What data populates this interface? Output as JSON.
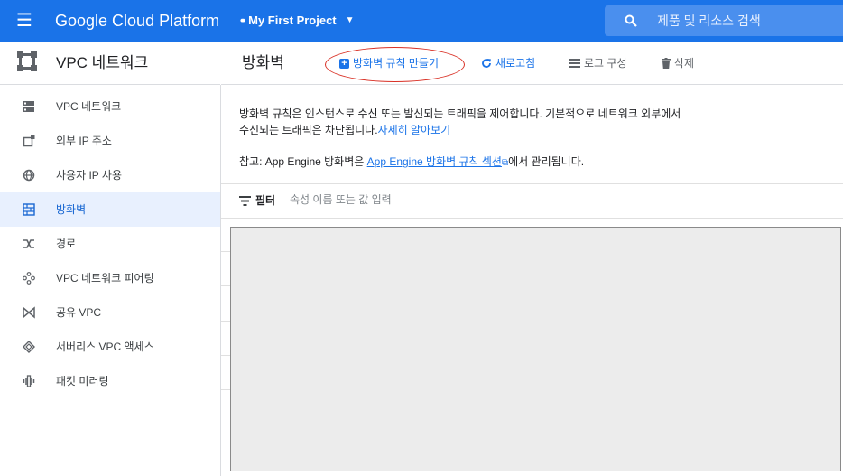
{
  "topbar": {
    "brand": "Google Cloud Platform",
    "project": "My First Project",
    "search_placeholder": "제품 및 리소스 검색",
    "bg_color": "#1a73e8"
  },
  "sidebar": {
    "title": "VPC 네트워크",
    "items": [
      {
        "label": "VPC 네트워크",
        "icon": "vpc-network-icon",
        "active": false
      },
      {
        "label": "외부 IP 주소",
        "icon": "external-ip-icon",
        "active": false
      },
      {
        "label": "사용자 IP 사용",
        "icon": "globe-icon",
        "active": false
      },
      {
        "label": "방화벽",
        "icon": "firewall-icon",
        "active": true
      },
      {
        "label": "경로",
        "icon": "routes-icon",
        "active": false
      },
      {
        "label": "VPC 네트워크 피어링",
        "icon": "peering-icon",
        "active": false
      },
      {
        "label": "공유 VPC",
        "icon": "shared-vpc-icon",
        "active": false
      },
      {
        "label": "서버리스 VPC 액세스",
        "icon": "serverless-icon",
        "active": false
      },
      {
        "label": "패킷 미러링",
        "icon": "packet-mirroring-icon",
        "active": false
      }
    ]
  },
  "main": {
    "title": "방화벽",
    "toolbar": {
      "create": "방화벽 규칙 만들기",
      "refresh": "새로고침",
      "logs": "로그 구성",
      "delete": "삭제"
    },
    "description": "방화벽 규칙은 인스턴스로 수신 또는 발신되는 트래픽을 제어합니다. 기본적으로 네트워크 외부에서 수신되는 트래픽은 차단됩니다.",
    "learn_more": "자세히 알아보기",
    "note_prefix": "참고: App Engine 방화벽은 ",
    "note_link": "App Engine 방화벽 규칙 섹션",
    "note_suffix": "에서 관리됩니다.",
    "filter": {
      "label": "필터",
      "placeholder": "속성 이름 또는 값 입력"
    }
  },
  "accent_color": "#1a73e8",
  "annotation_color": "#d93025"
}
